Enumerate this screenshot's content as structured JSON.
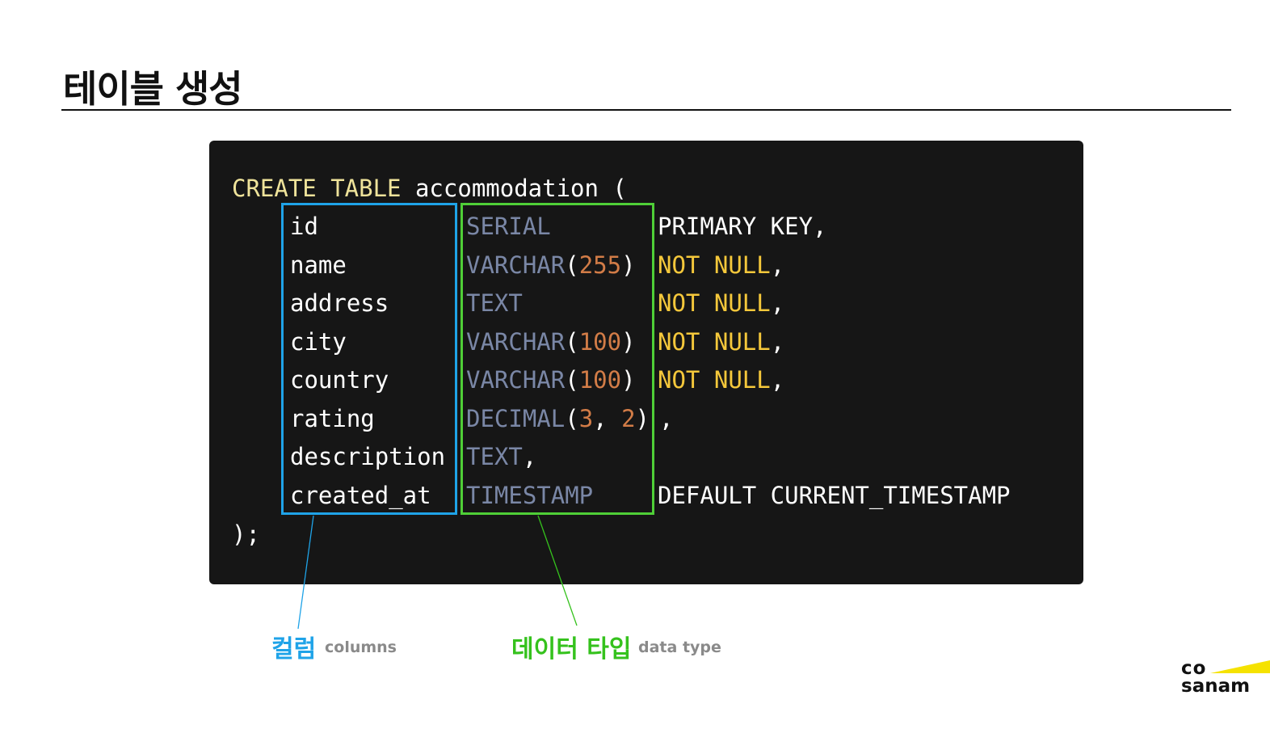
{
  "slide": {
    "title": "테이블 생성"
  },
  "code": {
    "create_kw": "CREATE TABLE",
    "table_name": " accommodation (",
    "closing": ");",
    "rows": [
      {
        "col": "id",
        "type": "SERIAL",
        "args": [],
        "constraint_plain": "PRIMARY KEY,",
        "nn1": "",
        "nn2": "",
        "suffix": ""
      },
      {
        "col": "name",
        "type": "VARCHAR",
        "args": [
          "255"
        ],
        "constraint_plain": "",
        "nn1": "NOT",
        "nn2": "NULL",
        "suffix": ","
      },
      {
        "col": "address",
        "type": "TEXT",
        "args": [],
        "constraint_plain": "",
        "nn1": "NOT",
        "nn2": "NULL",
        "suffix": ","
      },
      {
        "col": "city",
        "type": "VARCHAR",
        "args": [
          "100"
        ],
        "constraint_plain": "",
        "nn1": "NOT",
        "nn2": "NULL",
        "suffix": ","
      },
      {
        "col": "country",
        "type": "VARCHAR",
        "args": [
          "100"
        ],
        "constraint_plain": "",
        "nn1": "NOT",
        "nn2": "NULL",
        "suffix": ","
      },
      {
        "col": "rating",
        "type": "DECIMAL",
        "args": [
          "3",
          "2"
        ],
        "constraint_plain": ",",
        "nn1": "",
        "nn2": "",
        "suffix": ""
      },
      {
        "col": "description",
        "type": "TEXT",
        "args": [],
        "constraint_plain": "",
        "nn1": "",
        "nn2": "",
        "suffix": "",
        "type_suffix": ","
      },
      {
        "col": "created_at",
        "type": "TIMESTAMP",
        "args": [],
        "constraint_plain": "DEFAULT CURRENT_TIMESTAMP",
        "nn1": "",
        "nn2": "",
        "suffix": ""
      }
    ]
  },
  "annotations": {
    "columns": {
      "label": "컬럼",
      "sub": "columns",
      "color": "#1fa3e8"
    },
    "data_type": {
      "label": "데이터 타입",
      "sub": "data type",
      "color": "#35c21d"
    }
  },
  "logo": {
    "line1": "co",
    "line2": "sanam",
    "accent": "#f5e200"
  },
  "colors": {
    "panel": "#161616",
    "keyword": "#efe39a",
    "type": "#7a87a6",
    "number": "#d27c47",
    "not_null": "#f5c83b"
  }
}
